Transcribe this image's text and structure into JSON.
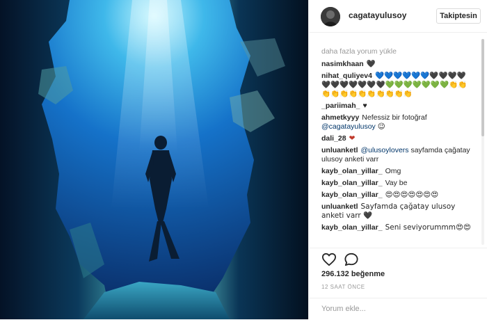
{
  "header": {
    "username": "cagatayulusoy",
    "follow_label": "Takiptesin"
  },
  "comments": {
    "load_more": "daha fazla yorum yükle",
    "items": [
      {
        "user": "nasimkhaan",
        "text": "🖤"
      },
      {
        "user": "nihat_quliyev4",
        "text": "💙💙💙💙💙💙🖤🖤🖤🖤🖤🖤🖤🖤🖤🖤🖤💚💚💚💚💚💚💚👏👏👏👏👏👏👏👏👏👏👏👏"
      },
      {
        "user": "_pariimah_",
        "text": "♥"
      },
      {
        "user": "ahmetkyyy",
        "text": "Nefessiz bir fotoğraf",
        "mention": "@cagatayulusoy",
        "suffix": "😉"
      },
      {
        "user": "dali_28",
        "text": "❤"
      },
      {
        "user": "unluanketl",
        "mention": "@ulusoylovers",
        "text": "sayfamda çağatay ulusoy anketi varr"
      },
      {
        "user": "kayb_olan_yillar_",
        "text": "Omg"
      },
      {
        "user": "kayb_olan_yillar_",
        "text": "Vay be"
      },
      {
        "user": "kayb_olan_yillar_",
        "text": "😍😍😍😍😍😍😍"
      },
      {
        "user": "unluanketl",
        "text": "Sayfamda çağatay ulusoy anketi varr 🖤"
      },
      {
        "user": "kayb_olan_yillar_",
        "text": "Seni seviyorummm😍😍"
      }
    ]
  },
  "actions": {
    "like_icon": "heart-icon",
    "comment_icon": "comment-icon"
  },
  "likes": {
    "count_text": "296.132 beğenme"
  },
  "timestamp": "12 SAAT ÖNCE",
  "comment_input": {
    "placeholder": "Yorum ekle..."
  }
}
